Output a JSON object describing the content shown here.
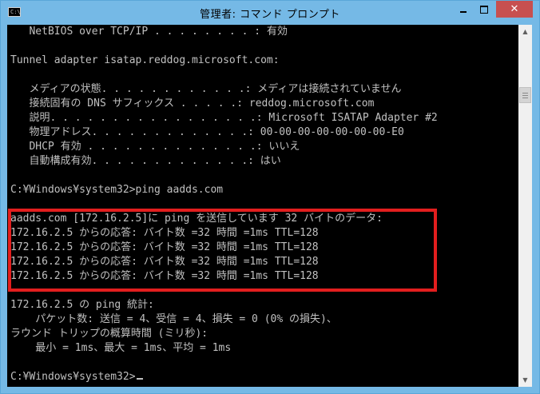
{
  "window": {
    "title": "管理者: コマンド プロンプト",
    "app_icon_text": "C:\\",
    "icons": {
      "app": "console-icon",
      "minimize": "minimize-icon",
      "maximize": "maximize-icon",
      "close": "close-icon"
    },
    "close_glyph": "✕"
  },
  "console": {
    "lines": [
      "   NetBIOS over TCP/IP . . . . . . . . : 有効",
      "",
      "Tunnel adapter isatap.reddog.microsoft.com:",
      "",
      "   メディアの状態. . . . . . . . . . . .: メディアは接続されていません",
      "   接続固有の DNS サフィックス . . . . .: reddog.microsoft.com",
      "   説明. . . . . . . . . . . . . . . . .: Microsoft ISATAP Adapter #2",
      "   物理アドレス. . . . . . . . . . . . .: 00-00-00-00-00-00-00-E0",
      "   DHCP 有効 . . . . . . . . . . . . . .: いいえ",
      "   自動構成有効. . . . . . . . . . . . .: はい",
      "",
      "C:¥Windows¥system32>ping aadds.com",
      "",
      "aadds.com [172.16.2.5]に ping を送信しています 32 バイトのデータ:",
      "172.16.2.5 からの応答: バイト数 =32 時間 =1ms TTL=128",
      "172.16.2.5 からの応答: バイト数 =32 時間 =1ms TTL=128",
      "172.16.2.5 からの応答: バイト数 =32 時間 =1ms TTL=128",
      "172.16.2.5 からの応答: バイト数 =32 時間 =1ms TTL=128",
      "",
      "172.16.2.5 の ping 統計:",
      "    パケット数: 送信 = 4、受信 = 4、損失 = 0 (0% の損失)、",
      "ラウンド トリップの概算時間 (ミリ秒):",
      "    最小 = 1ms、最大 = 1ms、平均 = 1ms",
      "",
      "C:¥Windows¥system32>"
    ]
  },
  "colors": {
    "titlebar": "#75b9e6",
    "console_bg": "#000000",
    "console_text": "#c0c0c0",
    "highlight_border": "#e21e1e",
    "close_button": "#c75050"
  },
  "scrollbar": {
    "up_glyph": "▲",
    "down_glyph": "▼"
  }
}
